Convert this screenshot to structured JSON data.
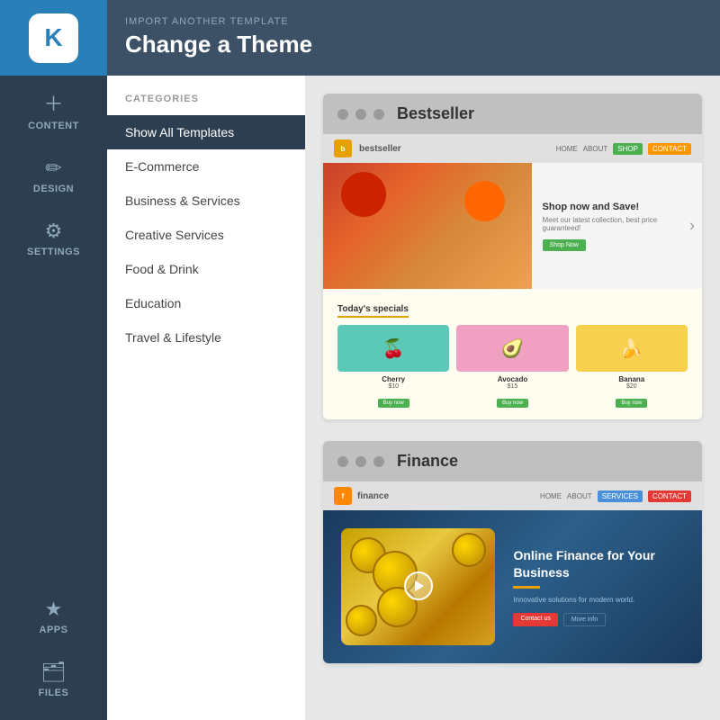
{
  "sidebar": {
    "logo_letter": "K",
    "items": [
      {
        "id": "content",
        "label": "CONTENT",
        "icon": "+"
      },
      {
        "id": "design",
        "label": "DESIGN",
        "icon": "✏"
      },
      {
        "id": "settings",
        "label": "SETTINGS",
        "icon": "⚙"
      }
    ],
    "bottom_items": [
      {
        "id": "apps",
        "label": "APPS",
        "icon": "★"
      },
      {
        "id": "files",
        "label": "FILES",
        "icon": "📁"
      }
    ]
  },
  "header": {
    "subtitle": "IMPORT ANOTHER TEMPLATE",
    "title": "Change a Theme"
  },
  "categories": {
    "label": "CATEGORIES",
    "items": [
      {
        "id": "show-all",
        "label": "Show All Templates",
        "active": true
      },
      {
        "id": "e-commerce",
        "label": "E-Commerce",
        "active": false
      },
      {
        "id": "business-services",
        "label": "Business & Services",
        "active": false
      },
      {
        "id": "creative-services",
        "label": "Creative Services",
        "active": false
      },
      {
        "id": "food-drink",
        "label": "Food & Drink",
        "active": false
      },
      {
        "id": "education",
        "label": "Education",
        "active": false
      },
      {
        "id": "travel-lifestyle",
        "label": "Travel & Lifestyle",
        "active": false
      }
    ]
  },
  "templates": [
    {
      "id": "bestseller",
      "name": "Bestseller",
      "nav": {
        "logo_label": "bestseller",
        "links": [
          "HOME",
          "ABOUT"
        ],
        "shop_label": "SHOP",
        "contact_label": "CONTACT"
      },
      "hero": {
        "title": "Shop now and Save!",
        "subtitle": "Meet our latest collection, best price guaranteed!",
        "button_label": "Shop Now"
      },
      "specials_title": "Today's specials",
      "products": [
        {
          "name": "Cherry",
          "price": "$10",
          "emoji": "🍒",
          "bg": "teal"
        },
        {
          "name": "Avocado",
          "price": "$15",
          "emoji": "🥑",
          "bg": "pink"
        },
        {
          "name": "Banana",
          "price": "$20",
          "emoji": "🍌",
          "bg": "yellow"
        }
      ]
    },
    {
      "id": "finance",
      "name": "Finance",
      "nav": {
        "logo_label": "finance",
        "links": [
          "HOME",
          "ABOUT"
        ],
        "services_label": "SERVICES",
        "contact_label": "CONTACT"
      },
      "hero": {
        "title": "Online Finance for Your Business",
        "subtitle": "Innovative solutions for modern world.",
        "contact_label": "Contact us",
        "more_label": "More info"
      }
    }
  ],
  "colors": {
    "sidebar_bg": "#2c3e50",
    "sidebar_header": "#2980b9",
    "header_bg": "#3d5166",
    "active_category": "#2c3e50",
    "bestseller_shop": "#4caf50",
    "bestseller_contact": "#ff9800",
    "finance_services": "#4a90d9",
    "finance_contact": "#e53935"
  }
}
